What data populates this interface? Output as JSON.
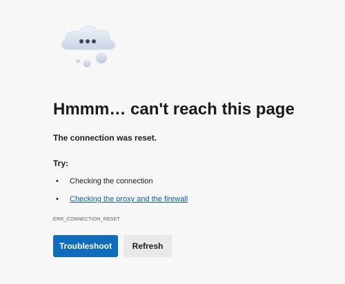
{
  "error_page": {
    "illustration": "cloud-with-dots-icon",
    "heading": "Hmmm… can't reach this page",
    "reason": "The connection was reset.",
    "try_label": "Try:",
    "suggestions": [
      {
        "bullet": "•",
        "text": "Checking the connection",
        "is_link": false
      },
      {
        "bullet": "•",
        "text": "Checking the proxy and the firewall",
        "is_link": true
      }
    ],
    "error_code": "ERR_CONNECTION_RESET",
    "buttons": {
      "troubleshoot_label": "Troubleshoot",
      "refresh_label": "Refresh"
    }
  },
  "colors": {
    "page_background": "#f7f7f7",
    "primary_button": "#0f6cbd",
    "secondary_button": "#e9e9e9",
    "link": "#0f5cb5"
  }
}
